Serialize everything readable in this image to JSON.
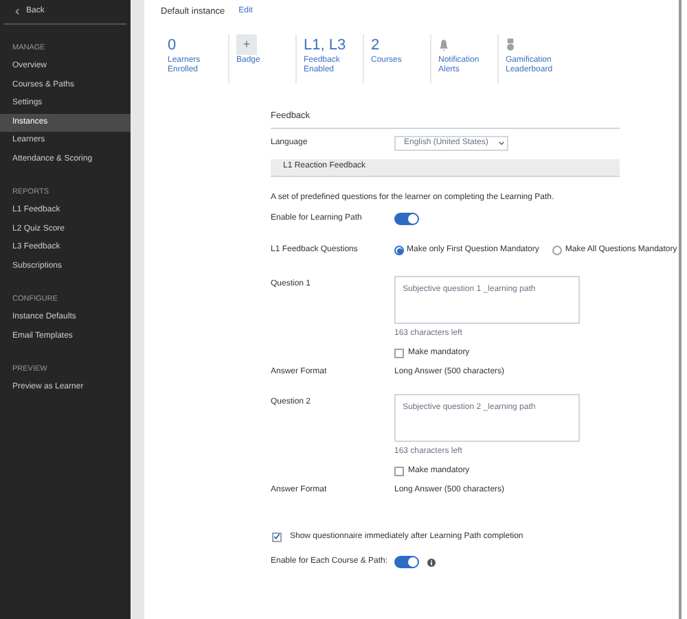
{
  "sidebar": {
    "back": "Back",
    "sections": [
      {
        "heading": "MANAGE",
        "items": [
          {
            "label": "Overview",
            "selected": false
          },
          {
            "label": "Courses & Paths",
            "selected": false
          },
          {
            "label": "Settings",
            "selected": false
          },
          {
            "label": "Instances",
            "selected": true
          },
          {
            "label": "Learners",
            "selected": false
          },
          {
            "label": "Attendance & Scoring",
            "selected": false
          }
        ]
      },
      {
        "heading": "REPORTS",
        "items": [
          {
            "label": "L1 Feedback",
            "selected": false
          },
          {
            "label": "L2 Quiz Score",
            "selected": false
          },
          {
            "label": "L3 Feedback",
            "selected": false
          },
          {
            "label": "Subscriptions",
            "selected": false
          }
        ]
      },
      {
        "heading": "CONFIGURE",
        "items": [
          {
            "label": "Instance Defaults",
            "selected": false
          },
          {
            "label": "Email Templates",
            "selected": false
          }
        ]
      },
      {
        "heading": "PREVIEW",
        "items": [
          {
            "label": "Preview as Learner",
            "selected": false
          }
        ]
      }
    ]
  },
  "header": {
    "title": "Default instance",
    "edit": "Edit"
  },
  "stats": [
    {
      "kind": "value",
      "value": "0",
      "label": "Learners Enrolled"
    },
    {
      "kind": "badge",
      "value": "+",
      "label": "Badge"
    },
    {
      "kind": "value",
      "value": "L1, L3",
      "label": "Feedback Enabled"
    },
    {
      "kind": "value",
      "value": "2",
      "label": "Courses"
    },
    {
      "kind": "bell",
      "label": "Notification Alerts"
    },
    {
      "kind": "medal",
      "label": "Gamification Leaderboard"
    }
  ],
  "feedback": {
    "title": "Feedback",
    "language_label": "Language",
    "language": "English (United States)",
    "section": "L1 Reaction Feedback",
    "description": "A set of predefined questions for the learner on completing the Learning Path.",
    "enable_label": "Enable for Learning Path",
    "enable_on": true,
    "questions_label": "L1 Feedback Questions",
    "options": [
      {
        "label": "Make only First Question Mandatory",
        "selected": true
      },
      {
        "label": "Make All Questions Mandatory",
        "selected": false
      }
    ],
    "questions": [
      {
        "label": "Question 1",
        "value": "Subjective question 1 _learning path",
        "chars_left": "163 characters left",
        "mandatory_label": "Make mandatory",
        "checked": false,
        "format_label": "Answer Format",
        "format": "Long Answer (500 characters)"
      },
      {
        "label": "Question 2",
        "value": "Subjective question 2 _learning path",
        "chars_left": "163 characters left",
        "mandatory_label": "Make mandatory",
        "checked": false,
        "format_label": "Answer Format",
        "format": "Long Answer (500 characters)"
      }
    ],
    "show_label": "Show questionnaire immediately after Learning Path completion",
    "show_checked": true,
    "each_label": "Enable for Each Course & Path:",
    "each_on": true
  }
}
